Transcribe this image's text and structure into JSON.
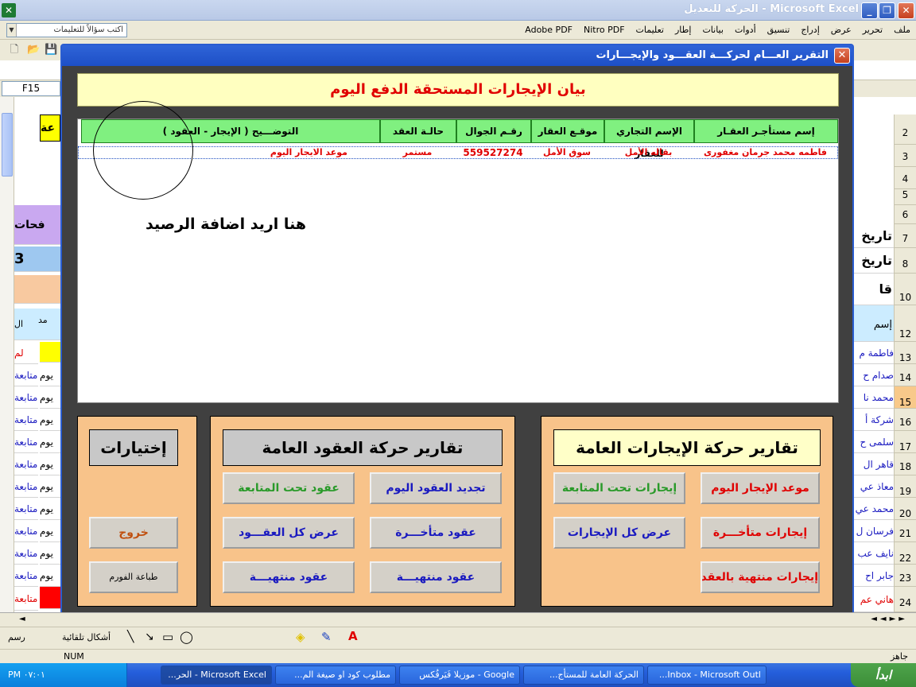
{
  "window": {
    "title": "Microsoft Excel - الحركة للتعديل"
  },
  "menu": {
    "items": [
      "ملف",
      "تحرير",
      "عرض",
      "إدراج",
      "تنسيق",
      "أدوات",
      "بيانات",
      "إطار",
      "تعليمات",
      "Nitro PDF",
      "Adobe PDF"
    ],
    "ask_placeholder": "اكتب سؤالاً للتعليمات"
  },
  "formula": {
    "name_box": "F15"
  },
  "sheet": {
    "row_numbers": [
      "2",
      "3",
      "4",
      "5",
      "6",
      "7",
      "8",
      "10",
      "12",
      "13",
      "14",
      "15",
      "16",
      "17",
      "18",
      "19",
      "20",
      "21",
      "22",
      "23",
      "24"
    ],
    "left_cells": [
      "متابعة",
      "متابعة",
      "متابعة",
      "متابعة",
      "متابعة",
      "متابعة",
      "متابعة",
      "متابعة",
      "متابعة",
      "متابعة",
      "متابعة"
    ],
    "left_cells2": [
      "يوم",
      "يوم",
      "يوم",
      "يوم",
      "يوم",
      "يوم",
      "يوم",
      "يوم",
      "يوم",
      "يوم"
    ],
    "right_cells": [
      "فاطمة م",
      "صدام ح",
      "محمد نا",
      "شركة أ",
      "سلمى ح",
      "قاهر ال",
      "معاذ عي",
      "محمد عي",
      "فرسان ل",
      "نايف عب",
      "جابر اح",
      "هاني عم"
    ],
    "right_labels": [
      "تاريخ",
      "تاريخ",
      "قا",
      "إسم"
    ],
    "left_labels": [
      "فحات",
      "3",
      "ال",
      "لم",
      "مد",
      "عة"
    ]
  },
  "form": {
    "title": "التقرير العـــام لحركـــة العقـــود والإيجـــارات",
    "report_title": "بيان الإيجارات المستحقة الدفع اليوم",
    "columns": [
      "إسم مستأجـر العقـار",
      "الإسم التجاري للعقار",
      "موقـع العقار",
      "رقـم الجوال",
      "حالـة العقد",
      "التوضـــيح ( الإيجار - العقود )"
    ],
    "row": {
      "tenant": "فاطمه محمد جرمان مغفورى",
      "trade_name": "بقاله الأمل",
      "location": "سوق الأمل",
      "phone": "559527274",
      "status": "مستمر",
      "note": "موعد الايجار اليوم"
    },
    "annotation": "هنا اريد اضافة الرصيد",
    "panels": {
      "leases": {
        "heading": "تقارير حركة الإيجارات العامة",
        "buttons": {
          "today": "موعد الإيجار اليوم",
          "followup": "إيجارات تحت المتابعة",
          "late": "إيجارات متأخـــرة",
          "all": "عرض كل الإيجارات",
          "ended": "إيجارات منتهية بالعقد"
        }
      },
      "contracts": {
        "heading": "تقارير حركة العقود العامة",
        "buttons": {
          "renew": "تجديد العقود اليوم",
          "followup": "عقود تحت المتابعة",
          "late": "عقود متأخـــرة",
          "all": "عرض كل العقـــود",
          "ended1": "عقود منتهيـــة",
          "ended2": "عقود منتهيـــة"
        }
      },
      "options": {
        "heading": "إختيارات",
        "buttons": {
          "exit": "خروج",
          "print": "طباعة الفورم"
        }
      }
    }
  },
  "status": {
    "left": "NUM",
    "right": "جاهز"
  },
  "drawing": {
    "autoshapes": "أشكال تلقائية",
    "draw": "رسم"
  },
  "taskbar": {
    "start": "ابدأ",
    "clock": "PM ٠٧:٠١",
    "tasks": [
      "Inbox - Microsoft Outl...",
      "الحركة العامة للمستأج...",
      "Google - موزيلا فَيَرفُكس",
      "مطلوب كود او صيغة الم...",
      "Microsoft Excel - الحر..."
    ]
  }
}
